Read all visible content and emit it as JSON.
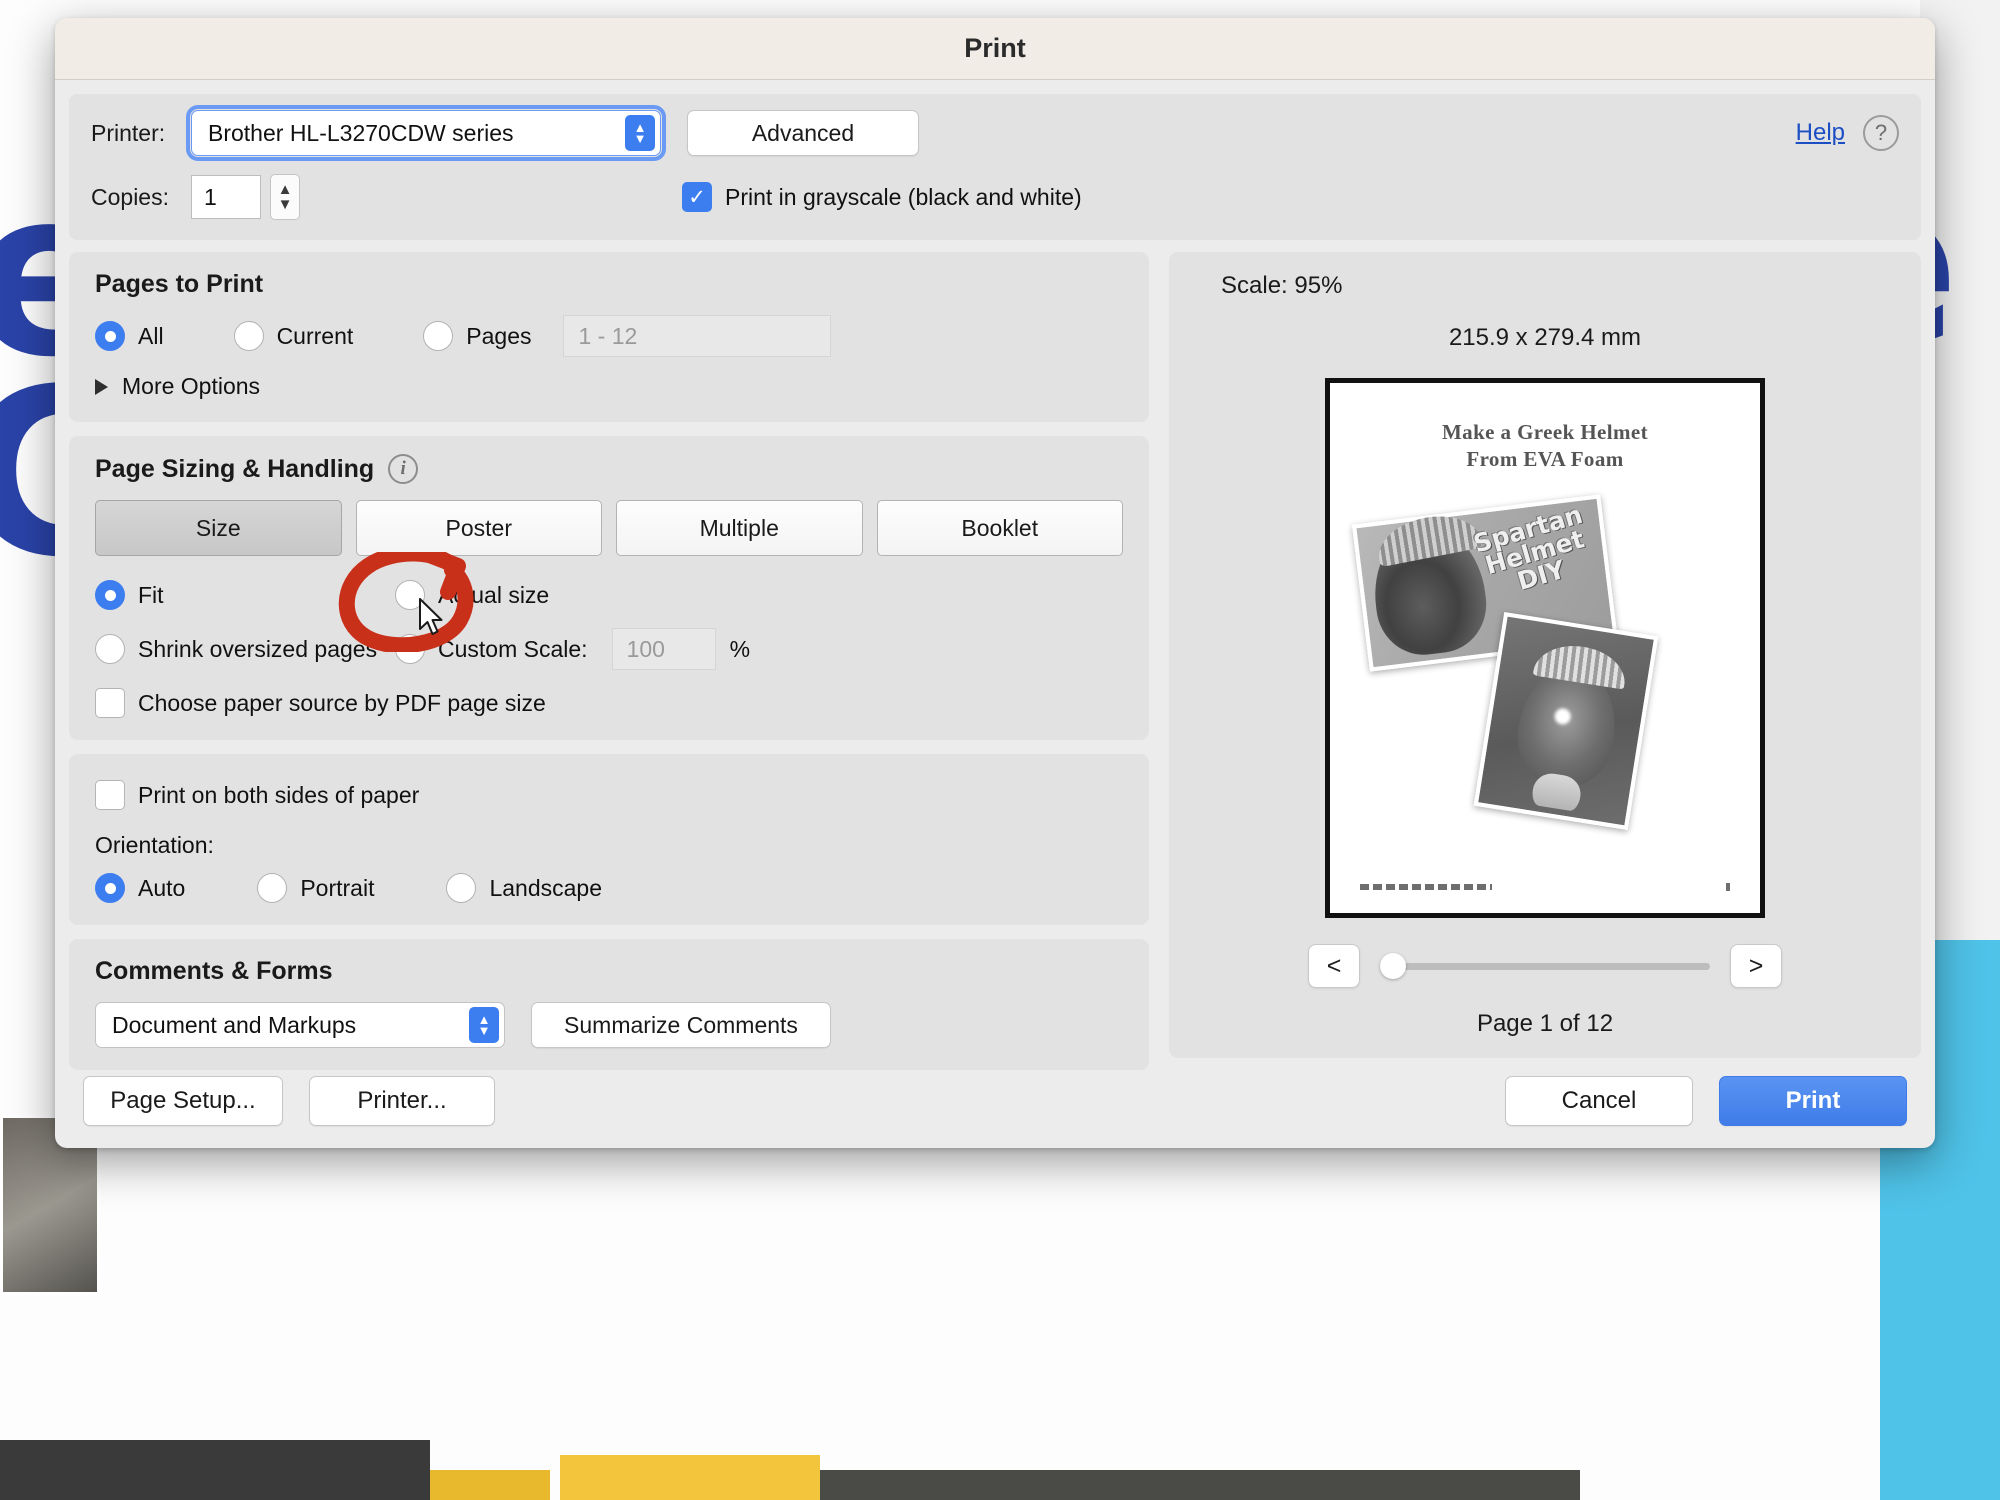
{
  "window": {
    "title": "Print"
  },
  "top": {
    "printer_label": "Printer:",
    "printer_value": "Brother HL-L3270CDW series",
    "advanced_label": "Advanced",
    "help_label": "Help",
    "help_icon": "question-mark-icon",
    "copies_label": "Copies:",
    "copies_value": "1",
    "grayscale_label": "Print in grayscale (black and white)",
    "grayscale_checked": true
  },
  "pages_to_print": {
    "title": "Pages to Print",
    "options": [
      {
        "label": "All",
        "selected": true
      },
      {
        "label": "Current",
        "selected": false
      },
      {
        "label": "Pages",
        "selected": false
      }
    ],
    "pages_placeholder": "1 - 12",
    "more_options_label": "More Options"
  },
  "page_sizing": {
    "title": "Page Sizing & Handling",
    "info_icon": "info-icon",
    "segments": [
      {
        "label": "Size",
        "active": true
      },
      {
        "label": "Poster",
        "active": false
      },
      {
        "label": "Multiple",
        "active": false
      },
      {
        "label": "Booklet",
        "active": false
      }
    ],
    "fit_label": "Fit",
    "fit_selected": true,
    "actual_size_label": "Actual size",
    "actual_size_selected": false,
    "shrink_label": "Shrink oversized pages",
    "shrink_selected": false,
    "custom_scale_label": "Custom Scale:",
    "custom_scale_selected": false,
    "custom_scale_value": "100",
    "percent_sign": "%",
    "paper_source_label": "Choose paper source by PDF page size",
    "paper_source_checked": false
  },
  "duplex": {
    "both_sides_label": "Print on both sides of paper",
    "both_sides_checked": false,
    "orientation_label": "Orientation:",
    "orientation_options": [
      {
        "label": "Auto",
        "selected": true
      },
      {
        "label": "Portrait",
        "selected": false
      },
      {
        "label": "Landscape",
        "selected": false
      }
    ]
  },
  "comments_forms": {
    "title": "Comments & Forms",
    "selected": "Document and Markups",
    "summarize_label": "Summarize Comments"
  },
  "preview": {
    "scale_label": "Scale:",
    "scale_value": "95%",
    "dimensions": "215.9 x 279.4 mm",
    "document_title_line1": "Make a Greek Helmet",
    "document_title_line2": "From EVA Foam",
    "photo_text_line1": "Spartan",
    "photo_text_line2": "Helmet",
    "photo_text_line3": "DIY",
    "prev_label": "<",
    "next_label": ">",
    "page_count_label": "Page 1 of 12"
  },
  "footer": {
    "page_setup_label": "Page Setup...",
    "printer_label": "Printer...",
    "cancel_label": "Cancel",
    "print_label": "Print"
  },
  "annotation": {
    "shape": "red-ellipse-with-arrow",
    "color": "#c9301a",
    "target": "actual-size-radio",
    "cursor": "arrow-pointer"
  },
  "background": {
    "glyph1": "e",
    "glyph2": "C",
    "glyph3": "e"
  }
}
